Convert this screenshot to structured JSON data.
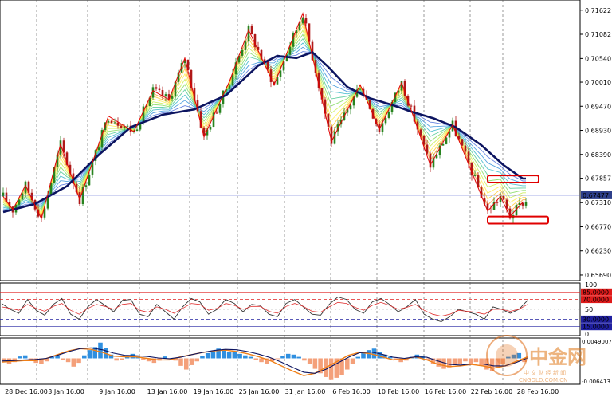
{
  "chart_data": [
    {
      "type": "candlestick",
      "panel": "price",
      "ylim": [
        0.656,
        0.7185
      ],
      "y_ticks": [
        "0.71622",
        "0.71082",
        "0.70540",
        "0.70010",
        "0.69470",
        "0.68930",
        "0.68390",
        "0.67857",
        "0.67310",
        "0.66770",
        "0.66230",
        "0.65690"
      ],
      "x_ticks": [
        "28 Dec 16:00",
        "3 Jan 16:00",
        "9 Jan 16:00",
        "13 Jan 16:00",
        "19 Jan 16:00",
        "25 Jan 16:00",
        "31 Jan 16:00",
        "6 Feb 16:00",
        "10 Feb 16:00",
        "16 Feb 16:00",
        "22 Feb 16:00",
        "28 Feb 16:00"
      ],
      "current_price": "0.67477",
      "current_price_value": 0.67477,
      "zigzag": [
        {
          "i": 0,
          "p": 0.6745
        },
        {
          "i": 3,
          "p": 0.6715
        },
        {
          "i": 7,
          "p": 0.677
        },
        {
          "i": 12,
          "p": 0.6695
        },
        {
          "i": 18,
          "p": 0.6862
        },
        {
          "i": 24,
          "p": 0.6738
        },
        {
          "i": 33,
          "p": 0.6925
        },
        {
          "i": 41,
          "p": 0.689
        },
        {
          "i": 47,
          "p": 0.6982
        },
        {
          "i": 52,
          "p": 0.6962
        },
        {
          "i": 57,
          "p": 0.7055
        },
        {
          "i": 63,
          "p": 0.6878
        },
        {
          "i": 71,
          "p": 0.7003
        },
        {
          "i": 77,
          "p": 0.7118
        },
        {
          "i": 85,
          "p": 0.6995
        },
        {
          "i": 94,
          "p": 0.7155
        },
        {
          "i": 103,
          "p": 0.6868
        },
        {
          "i": 112,
          "p": 0.6995
        },
        {
          "i": 118,
          "p": 0.6895
        },
        {
          "i": 125,
          "p": 0.7
        },
        {
          "i": 134,
          "p": 0.6815
        },
        {
          "i": 141,
          "p": 0.6905
        },
        {
          "i": 152,
          "p": 0.6712
        },
        {
          "i": 156,
          "p": 0.6745
        },
        {
          "i": 159,
          "p": 0.67
        },
        {
          "i": 163,
          "p": 0.6732
        }
      ],
      "ma_curve": [
        {
          "i": 0,
          "p": 0.671
        },
        {
          "i": 10,
          "p": 0.6728
        },
        {
          "i": 20,
          "p": 0.6768
        },
        {
          "i": 30,
          "p": 0.6838
        },
        {
          "i": 40,
          "p": 0.69
        },
        {
          "i": 50,
          "p": 0.6928
        },
        {
          "i": 60,
          "p": 0.694
        },
        {
          "i": 70,
          "p": 0.6972
        },
        {
          "i": 80,
          "p": 0.7038
        },
        {
          "i": 86,
          "p": 0.706
        },
        {
          "i": 92,
          "p": 0.7055
        },
        {
          "i": 97,
          "p": 0.7068
        },
        {
          "i": 102,
          "p": 0.7035
        },
        {
          "i": 108,
          "p": 0.699
        },
        {
          "i": 115,
          "p": 0.6965
        },
        {
          "i": 122,
          "p": 0.695
        },
        {
          "i": 128,
          "p": 0.6935
        },
        {
          "i": 135,
          "p": 0.692
        },
        {
          "i": 142,
          "p": 0.69
        },
        {
          "i": 150,
          "p": 0.686
        },
        {
          "i": 157,
          "p": 0.6815
        },
        {
          "i": 163,
          "p": 0.6785
        }
      ],
      "boxes": [
        {
          "i_start": 152,
          "i_end": 168,
          "p_high": 0.6792,
          "p_low": 0.6776
        },
        {
          "i_start": 152,
          "i_end": 171,
          "p_high": 0.67,
          "p_low": 0.6684
        }
      ]
    },
    {
      "type": "line",
      "panel": "oscillator",
      "ylim": [
        0,
        100
      ],
      "y_ticks": [
        "100",
        "50",
        "0"
      ],
      "levels": [
        "85.0000",
        "70.0000",
        "30.0000",
        "15.0000"
      ],
      "level_values": [
        85,
        70,
        30,
        15
      ],
      "series": [
        {
          "values": [
            62,
            50,
            42,
            70,
            48,
            38,
            60,
            72,
            40,
            30,
            55,
            70,
            58,
            45,
            68,
            70,
            40,
            35,
            60,
            45,
            30,
            55,
            72,
            65,
            40,
            50,
            70,
            62,
            45,
            60,
            58,
            40,
            35,
            62,
            70,
            55,
            40,
            38,
            60,
            75,
            70,
            50,
            42,
            65,
            72,
            60,
            45,
            55,
            70,
            40,
            30,
            25,
            35,
            50,
            45,
            40,
            30,
            55,
            50,
            42,
            50,
            68
          ]
        },
        {
          "values": [
            55,
            52,
            48,
            60,
            52,
            46,
            56,
            62,
            48,
            40,
            52,
            60,
            56,
            50,
            60,
            62,
            48,
            44,
            55,
            50,
            42,
            52,
            62,
            60,
            48,
            52,
            62,
            58,
            50,
            56,
            56,
            46,
            42,
            56,
            62,
            56,
            46,
            44,
            55,
            64,
            62,
            54,
            48,
            58,
            64,
            58,
            50,
            54,
            60,
            48,
            40,
            36,
            40,
            48,
            46,
            44,
            40,
            50,
            50,
            46,
            50,
            60
          ]
        }
      ]
    },
    {
      "type": "bar",
      "panel": "histogram",
      "y_ticks": [
        "0.0049007",
        "-0.006413"
      ],
      "ylim": [
        -0.0065,
        0.005
      ],
      "values": [
        -0.0008,
        -0.0015,
        -0.001,
        0.0005,
        0.0008,
        -0.0005,
        -0.0012,
        -0.0015,
        -0.0008,
        0.0003,
        0.0006,
        -0.0004,
        -0.001,
        -0.0022,
        -0.0012,
        0.0008,
        0.0022,
        0.003,
        0.0042,
        0.0028,
        0.001,
        -0.0006,
        -0.0004,
        0.0004,
        0.0012,
        0.0006,
        -0.0003,
        -0.0008,
        -0.0012,
        -0.0006,
        0.0005,
        -0.0002,
        -0.0006,
        -0.002,
        -0.003,
        -0.0018,
        -0.0008,
        0.0006,
        0.0014,
        0.002,
        0.0026,
        0.0024,
        0.0018,
        0.0016,
        0.0012,
        0.0008,
        0.0004,
        -0.0004,
        -0.001,
        -0.0014,
        -0.0008,
        -0.0002,
        0.0006,
        0.0012,
        0.001,
        0.0004,
        -0.0006,
        -0.0016,
        -0.0028,
        -0.004,
        -0.005,
        -0.0058,
        -0.0052,
        -0.0044,
        -0.003,
        -0.0016,
        0.0004,
        0.0014,
        0.0022,
        0.0026,
        0.0018,
        0.001,
        0.0004,
        -0.0004,
        -0.001,
        -0.0006,
        0.0004,
        0.001,
        0.0006,
        -0.0004,
        -0.0014,
        -0.0022,
        -0.0028,
        -0.0024,
        -0.0018,
        -0.0014,
        -0.0008,
        -0.0016,
        -0.001,
        -0.002,
        -0.003,
        -0.0034,
        -0.0026,
        -0.0016,
        0.0004,
        0.001,
        0.0014,
        -0.001
      ],
      "signal": [
        -0.001,
        -0.0008,
        -0.0006,
        -0.0006,
        0.0,
        0.001,
        0.002,
        0.0026,
        0.0024,
        0.0016,
        0.0006,
        0.0004,
        0.0004,
        0.0,
        -0.0004,
        -0.0004,
        0.0004,
        0.001,
        0.0016,
        0.002,
        0.0022,
        0.0018,
        0.0012,
        0.0004,
        -0.0006,
        -0.002,
        -0.0034,
        -0.0046,
        -0.004,
        -0.0024,
        -0.0008,
        0.0008,
        0.0016,
        0.0012,
        0.0004,
        -0.0004,
        -0.0002,
        0.0004,
        -0.0004,
        -0.0016,
        -0.0022,
        -0.002,
        -0.0016,
        -0.002,
        -0.0026,
        -0.002,
        -0.0008,
        0.0004
      ]
    }
  ],
  "colors": {
    "bull": "#27831e",
    "bear": "#b01818",
    "zigzag": "#e00000",
    "ma_main": "#0c1460",
    "price_line": "#4a5fd0",
    "price_tag": "#2e3f8a",
    "level_tag": "#e01a1a",
    "level_tag_blue": "#2020a0",
    "hist_pos": "#2f8fe0",
    "hist_neg": "#f4a07a",
    "signal": "#f08018",
    "osc_main": "#333333",
    "osc_signal": "#e03030",
    "grid": "#555555"
  },
  "watermark": {
    "logo_text": "中金网",
    "tagline": "中 文 财 经 新 闻",
    "url": "CNGOLD.COM.CN"
  }
}
